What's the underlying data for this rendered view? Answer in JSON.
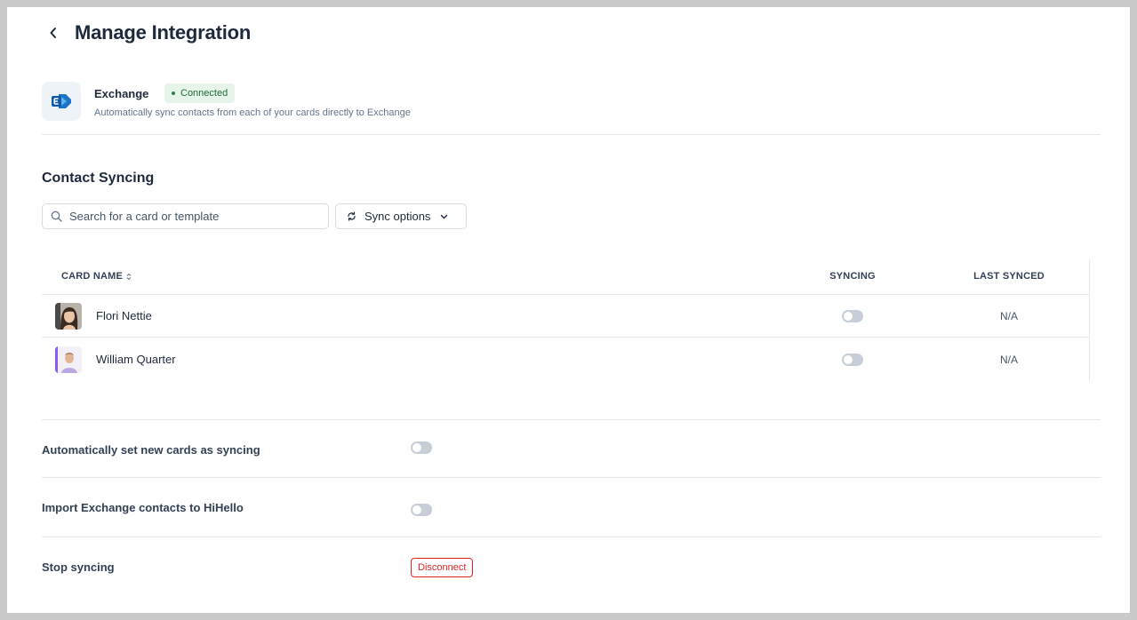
{
  "header": {
    "title": "Manage Integration",
    "back_icon": "chevron-left-icon"
  },
  "integration": {
    "name": "Exchange",
    "status": "Connected",
    "description": "Automatically sync contacts from each of your cards directly to Exchange",
    "logo_icon": "exchange-logo-icon",
    "status_color": "#1f6b3a"
  },
  "contact_syncing": {
    "title": "Contact Syncing",
    "search": {
      "placeholder": "Search for a card or template",
      "value": ""
    },
    "sync_options_label": "Sync options",
    "table": {
      "columns": [
        "CARD NAME",
        "SYNCING",
        "LAST SYNCED"
      ],
      "rows": [
        {
          "name": "Flori Nettie",
          "syncing": false,
          "last_synced": "N/A"
        },
        {
          "name": "William Quarter",
          "syncing": false,
          "last_synced": "N/A"
        }
      ]
    }
  },
  "settings": {
    "auto_sync": {
      "label": "Automatically set new cards as syncing",
      "enabled": false
    },
    "import": {
      "label": "Import Exchange contacts to HiHello",
      "enabled": false
    },
    "stop": {
      "label": "Stop syncing",
      "button": "Disconnect"
    }
  },
  "colors": {
    "danger": "#dc2626",
    "toggle_off": "#c8ced8",
    "badge_bg": "#e6f4ea"
  }
}
